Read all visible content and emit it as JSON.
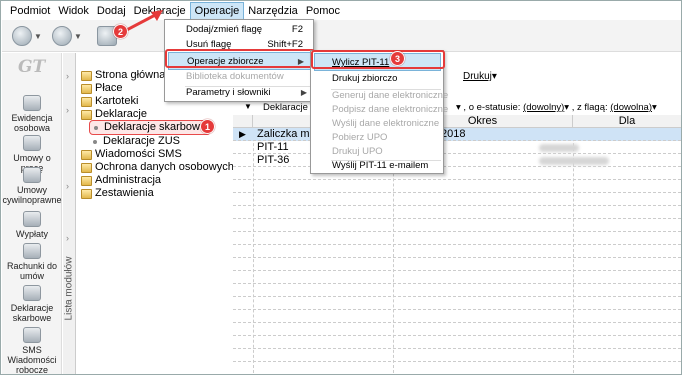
{
  "menubar": {
    "items": [
      "Podmiot",
      "Widok",
      "Dodaj",
      "Deklaracje",
      "Operacje",
      "Narzędzia",
      "Pomoc"
    ]
  },
  "iconbar": {
    "logo": "GT",
    "items": [
      {
        "label": "Ewidencja osobowa",
        "icon": "people-card-icon"
      },
      {
        "label": "Umowy o pracę",
        "icon": "contract-icon"
      },
      {
        "label": "Umowy cywilnoprawne",
        "icon": "civil-contract-icon"
      },
      {
        "label": "Wypłaty",
        "icon": "payments-icon"
      },
      {
        "label": "Rachunki do umów",
        "icon": "bills-icon"
      },
      {
        "label": "Deklaracje skarbowe",
        "icon": "tax-declaration-icon"
      },
      {
        "label": "SMS Wiadomości robocze",
        "icon": "sms-icon"
      }
    ]
  },
  "vtab_label": "Lista modułów",
  "tree": {
    "items": [
      {
        "label": "Strona główna"
      },
      {
        "label": "Płace"
      },
      {
        "label": "Kartoteki"
      },
      {
        "label": "Deklaracje"
      },
      {
        "label": "Deklaracje skarbowe"
      },
      {
        "label": "Deklaracje ZUS"
      },
      {
        "label": "Wiadomości SMS"
      },
      {
        "label": "Ochrona danych osobowych"
      },
      {
        "label": "Administracja"
      },
      {
        "label": "Zestawienia"
      }
    ]
  },
  "filters": {
    "drukuj": "Drukuj",
    "row_prefix": "Deklaracje z o",
    "estatus_label": ", o e-statusie:",
    "estatus_value": "(dowolny)",
    "flag_label": ", z flagą:",
    "flag_value": "(dowolna)"
  },
  "grid": {
    "headers": [
      "De",
      "Okres",
      "Dla"
    ],
    "rows": [
      {
        "name": "Zaliczka mie",
        "period": "2018"
      },
      {
        "name": "PIT-11",
        "period": ""
      },
      {
        "name": "PIT-36",
        "period": ""
      }
    ]
  },
  "menu_operacje": {
    "items": [
      {
        "label": "Dodaj/zmień flagę",
        "shortcut": "F2"
      },
      {
        "label": "Usuń flagę",
        "shortcut": "Shift+F2"
      },
      {
        "label": "Operacje zbiorcze",
        "shortcut": ""
      },
      {
        "label": "Biblioteka dokumentów",
        "shortcut": ""
      },
      {
        "label": "Parametry i słowniki",
        "shortcut": ""
      }
    ]
  },
  "menu_zbiorcze": {
    "items": [
      {
        "label": "Wylicz PIT-11"
      },
      {
        "label": "Drukuj zbiorczo"
      },
      {
        "label": "Generuj dane elektroniczne"
      },
      {
        "label": "Podpisz dane elektroniczne"
      },
      {
        "label": "Wyślij dane elektroniczne"
      },
      {
        "label": "Pobierz UPO"
      },
      {
        "label": "Drukuj UPO"
      },
      {
        "label": "Wyślij PIT-11 e-mailem"
      }
    ]
  },
  "badges": [
    "1",
    "2",
    "3"
  ],
  "colors": {
    "accent_red": "#e53a3a",
    "highlight_blue": "#cde6f7",
    "selected_row": "#cfe3f6"
  }
}
